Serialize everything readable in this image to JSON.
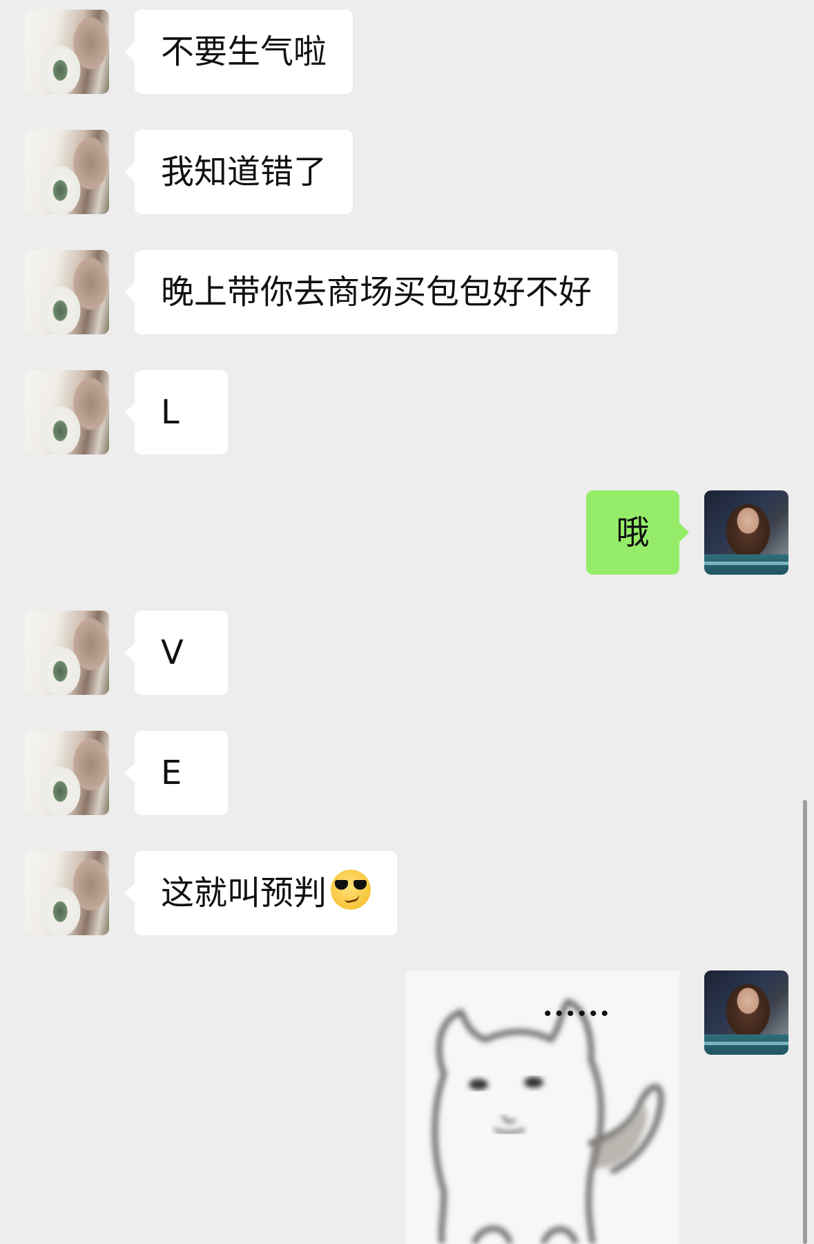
{
  "messages": [
    {
      "sender": "friend",
      "text": "不要生气啦"
    },
    {
      "sender": "friend",
      "text": "我知道错了"
    },
    {
      "sender": "friend",
      "text": "晚上带你去商场买包包好不好"
    },
    {
      "sender": "friend",
      "text": "L"
    },
    {
      "sender": "self",
      "text": "哦"
    },
    {
      "sender": "friend",
      "text": "V"
    },
    {
      "sender": "friend",
      "text": "E"
    },
    {
      "sender": "friend",
      "text": "这就叫预判",
      "emoji": "smiling-face-with-sunglasses"
    },
    {
      "sender": "self",
      "type": "sticker",
      "sticker": "cat-sticker",
      "sticker_text": "••••••"
    }
  ],
  "colors": {
    "background": "#ededed",
    "incoming_bubble": "#ffffff",
    "outgoing_bubble": "#95ec69"
  }
}
